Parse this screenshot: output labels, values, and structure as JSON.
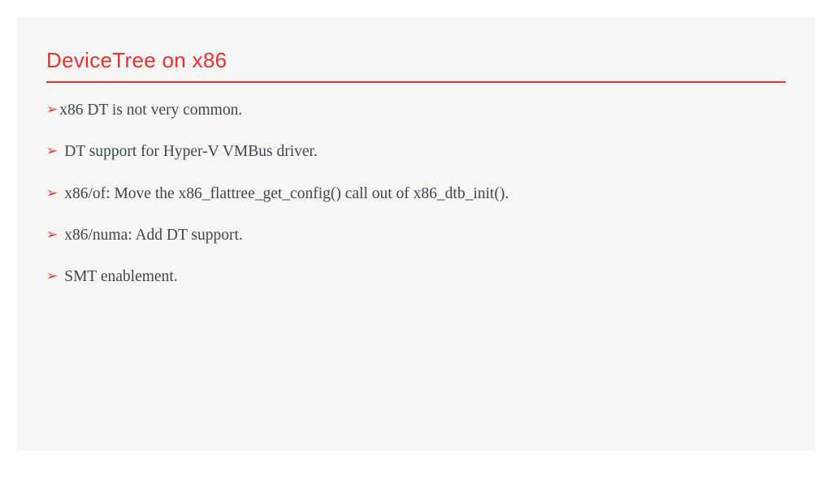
{
  "title": "DeviceTree on x86",
  "bullets": [
    "x86 DT is not very common.",
    "DT support for Hyper-V VMBus driver.",
    "x86/of: Move the x86_flattree_get_config() call out of x86_dtb_init().",
    "x86/numa: Add DT support.",
    "SMT enablement."
  ]
}
